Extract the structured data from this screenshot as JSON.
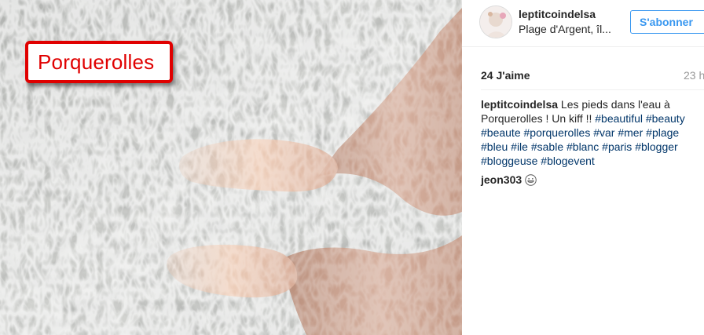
{
  "photo": {
    "overlay_label": "Porquerolles"
  },
  "header": {
    "username": "leptitcoindelsa",
    "location": "Plage d'Argent, îl...",
    "follow_label": "S'abonner",
    "accent_color": "#3897f0"
  },
  "stats": {
    "likes": "24 J'aime",
    "timestamp": "23 h"
  },
  "caption": {
    "username": "leptitcoindelsa",
    "lines": [
      {
        "text": "Les pieds dans l'eau à",
        "tags": []
      },
      {
        "text": "Porquerolles ! Un kiff !!",
        "tags": [
          "#beautiful",
          "#beauty"
        ]
      },
      {
        "text": "",
        "tags": [
          "#beaute",
          "#porquerolles",
          "#var",
          "#mer",
          "#plage"
        ]
      },
      {
        "text": "",
        "tags": [
          "#bleu",
          "#ile",
          "#sable",
          "#blanc",
          "#paris",
          "#blogger"
        ]
      },
      {
        "text": "",
        "tags": [
          "#bloggeuse",
          "#blogevent"
        ]
      }
    ],
    "hashtag_color": "#003569"
  },
  "comments": [
    {
      "username": "jeon303",
      "emoji": "grinning-face-icon"
    }
  ]
}
